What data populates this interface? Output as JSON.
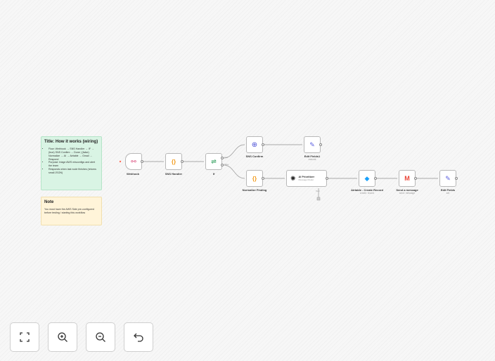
{
  "sticky_notes": [
    {
      "title": "Title: How it works (wiring)",
      "items": [
        "Flow: Webhook → SNS Handler → IF → (true) SNS Confirm → Done | (false) Normalize → AI → Airtable → Gmail → Respond",
        "Purpose: triage AWS misconfigs and alert the team",
        "Responds when last node finishes (returns small JSON)"
      ]
    },
    {
      "title": "Note",
      "items": [
        "You must have the AWS Side pre-configured before testing / starting this workflow"
      ]
    }
  ],
  "nodes": {
    "webhook": {
      "label": "Webhook",
      "icon": "webhook-icon"
    },
    "sns_handler": {
      "label": "SNS Handler",
      "icon": "code-braces-icon"
    },
    "if": {
      "label": "If",
      "icon": "signpost-icon",
      "out_true": "true",
      "out_false": "false"
    },
    "sns_confirm": {
      "label": "SNS Confirm",
      "icon": "globe-icon"
    },
    "edit_fields1": {
      "label": "Edit Fields1",
      "sub": "manual",
      "icon": "pencil-icon"
    },
    "normalize": {
      "label": "Normalize Finding",
      "icon": "code-braces-icon"
    },
    "ai": {
      "label": "AI Prioritizer",
      "sub": "Message Model",
      "icon": "openai-icon",
      "tool": "Tool"
    },
    "airtable": {
      "label": "Airtable - Create Record",
      "sub": "create: record",
      "icon": "airtable-icon"
    },
    "gmail": {
      "label": "Send a message",
      "sub": "send: message",
      "icon": "gmail-icon"
    },
    "edit_fields": {
      "label": "Edit Fields",
      "sub": "set",
      "icon": "pencil-icon"
    }
  },
  "controls": [
    "zoom-to-fit",
    "zoom-in",
    "zoom-out",
    "undo"
  ]
}
